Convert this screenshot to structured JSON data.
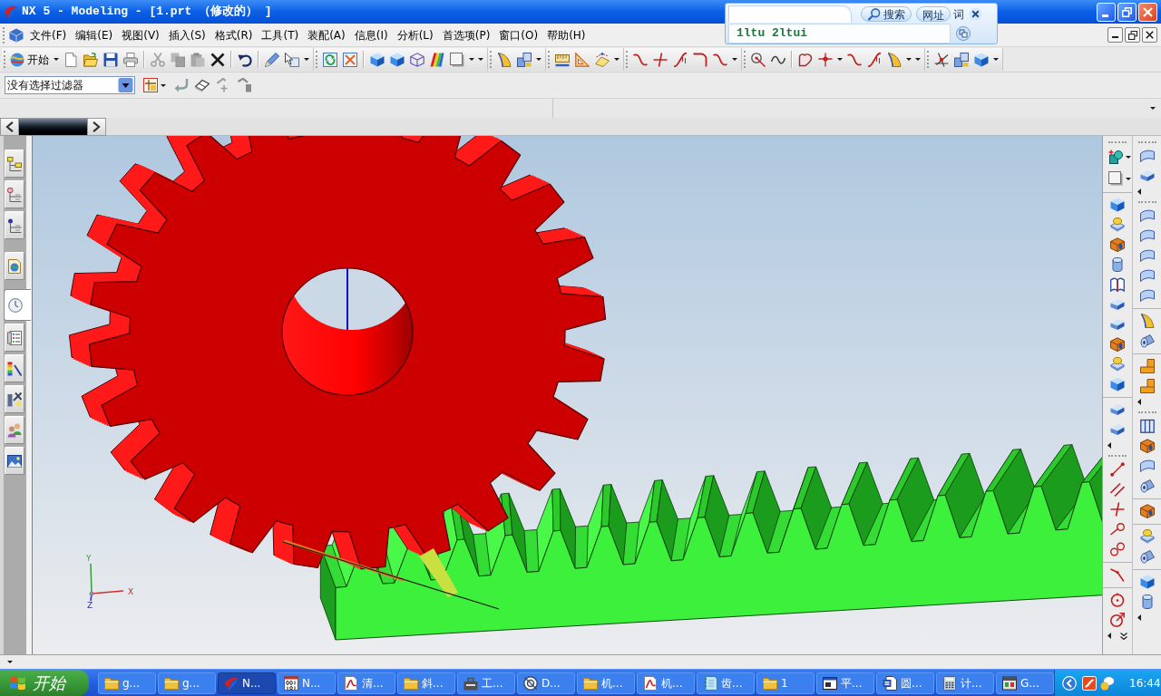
{
  "window": {
    "title": "NX 5 - Modeling - [1.prt （修改的） ]"
  },
  "search_popup": {
    "search_button": "搜索",
    "url_button": "网址",
    "word_button": "词",
    "input": {
      "value": "1ltu 2ltui"
    }
  },
  "menu_bar": {
    "items": [
      "文件(F)",
      "编辑(E)",
      "视图(V)",
      "插入(S)",
      "格式(R)",
      "工具(T)",
      "装配(A)",
      "信息(I)",
      "分析(L)",
      "首选项(P)",
      "窗口(O)",
      "帮助(H)"
    ]
  },
  "standard_toolbar": {
    "start_button": "开始"
  },
  "selection_bar": {
    "filter": "没有选择过滤器"
  },
  "resource_bar": {
    "tabs": [
      {
        "selected": false
      },
      {
        "selected": false
      },
      {
        "selected": false
      },
      {
        "selected": false
      },
      {
        "selected": true
      },
      {
        "selected": false
      },
      {
        "selected": false
      },
      {
        "selected": false
      },
      {
        "selected": false
      },
      {
        "selected": false
      }
    ]
  },
  "viewport": {
    "triad": {
      "x_label": "X",
      "y_label": "Y",
      "z_label": "Z"
    }
  },
  "taskbar": {
    "start_button": "开始",
    "tasks": [
      {
        "label": "g...",
        "selected": false
      },
      {
        "label": "g...",
        "selected": false
      },
      {
        "label": "N...",
        "selected": true
      },
      {
        "label": "N...",
        "selected": false
      },
      {
        "label": "清...",
        "selected": false
      },
      {
        "label": "斜...",
        "selected": false
      },
      {
        "label": "工...",
        "selected": false
      },
      {
        "label": "D...",
        "selected": false
      },
      {
        "label": "机...",
        "selected": false
      },
      {
        "label": "机...",
        "selected": false
      },
      {
        "label": "齿...",
        "selected": false
      },
      {
        "label": "1",
        "selected": false
      },
      {
        "label": "平...",
        "selected": false
      },
      {
        "label": "圆...",
        "selected": false
      },
      {
        "label": "计...",
        "selected": false
      },
      {
        "label": "G...",
        "selected": false
      }
    ],
    "clock": "16:44"
  }
}
